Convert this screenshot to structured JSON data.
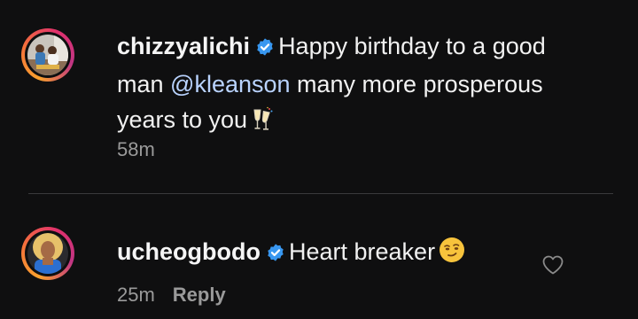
{
  "comments": [
    {
      "username": "chizzyalichi",
      "verified": true,
      "text_before": "Happy birthday to a good man ",
      "mention": "@kleanson",
      "text_after": " many more prosperous years to you",
      "emoji": "champagne-glasses-icon",
      "time": "58m"
    },
    {
      "username": "ucheogbodo",
      "verified": true,
      "text": "Heart breaker",
      "emoji": "smirking-face-icon",
      "time": "25m",
      "reply_label": "Reply",
      "like_icon": "heart-outline-icon"
    }
  ],
  "colors": {
    "background": "#0f0f10",
    "mention": "#b9d3ff",
    "meta": "#9a9a9a",
    "verified": "#3897f0",
    "divider": "#3a3a3c"
  }
}
